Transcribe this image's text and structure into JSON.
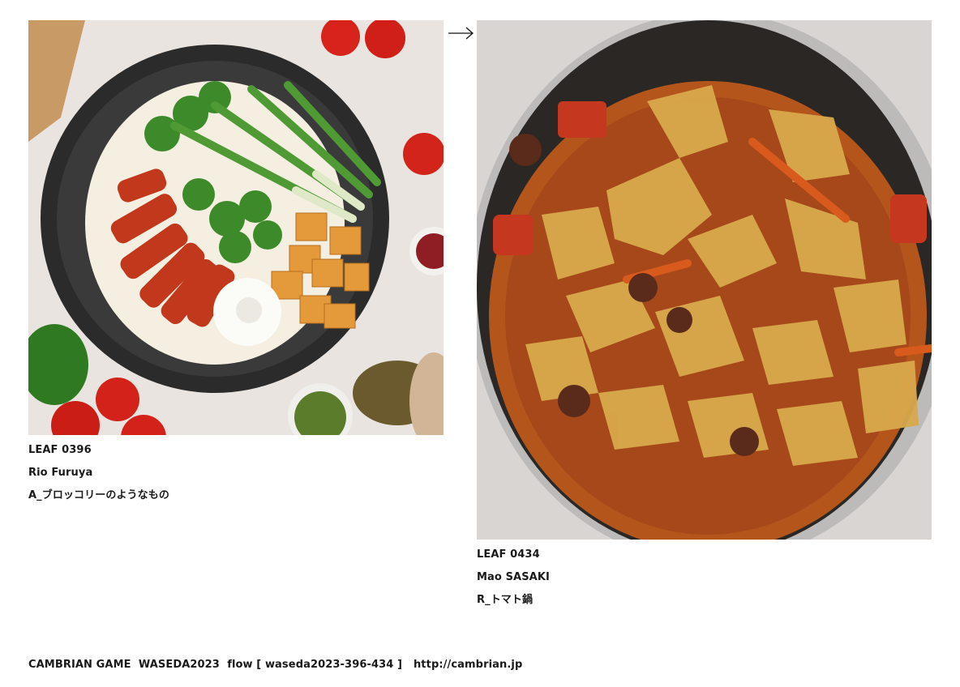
{
  "left_card": {
    "leaf": "LEAF 0396",
    "author": "Rio Furuya",
    "title": "A_ブロッコリーのようなもの",
    "image": "noodle-vegetable-platter-image"
  },
  "connector": {
    "icon": "right-arrow-icon"
  },
  "right_card": {
    "leaf": "LEAF 0434",
    "author": "Mao SASAKI",
    "title": "R_トマト鍋",
    "image": "tomato-hotpot-image"
  },
  "footer": {
    "text": "CAMBRIAN GAME  WASEDA2023  flow [ waseda2023-396-434 ]   http://cambrian.jp"
  }
}
